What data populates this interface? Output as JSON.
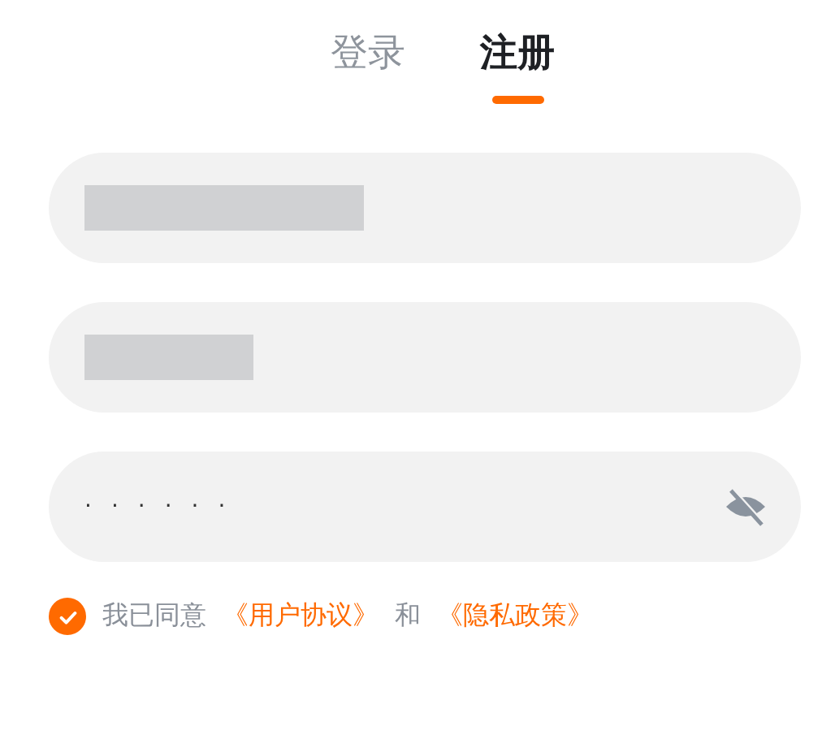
{
  "tabs": [
    {
      "label": "登录",
      "selected": false
    },
    {
      "label": "注册",
      "selected": true
    }
  ],
  "fields": [
    {
      "kind": "redacted"
    },
    {
      "kind": "redacted"
    },
    {
      "kind": "password",
      "value": "······",
      "revealed": false
    }
  ],
  "agreement": {
    "checked": true,
    "parts": [
      {
        "kind": "plain",
        "text": "我已同意"
      },
      {
        "kind": "link",
        "text": "《用户协议》"
      },
      {
        "kind": "plain",
        "text": "和"
      },
      {
        "kind": "link",
        "text": "《隐私政策》"
      }
    ]
  }
}
